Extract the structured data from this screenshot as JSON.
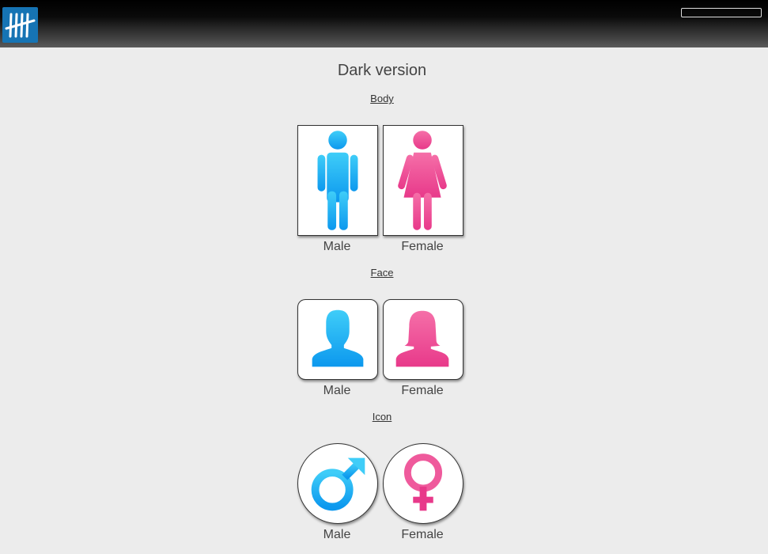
{
  "header": {
    "logo_icon": "tally-marks-icon",
    "logo_color": "#1674b4"
  },
  "page": {
    "title": "Dark version"
  },
  "sections": {
    "body": {
      "label": "Body",
      "male": {
        "label": "Male",
        "icon": "male-body-icon",
        "color": "#1eaaf1"
      },
      "female": {
        "label": "Female",
        "icon": "female-body-icon",
        "color": "#ee4d94"
      }
    },
    "face": {
      "label": "Face",
      "male": {
        "label": "Male",
        "icon": "male-face-icon",
        "color": "#1eaaf1"
      },
      "female": {
        "label": "Female",
        "icon": "female-face-icon",
        "color": "#ee4d94"
      }
    },
    "icon": {
      "label": "Icon",
      "male": {
        "label": "Male",
        "icon": "male-symbol-icon",
        "color": "#1eaaf1"
      },
      "female": {
        "label": "Female",
        "icon": "female-symbol-icon",
        "color": "#ee4d94"
      }
    }
  }
}
